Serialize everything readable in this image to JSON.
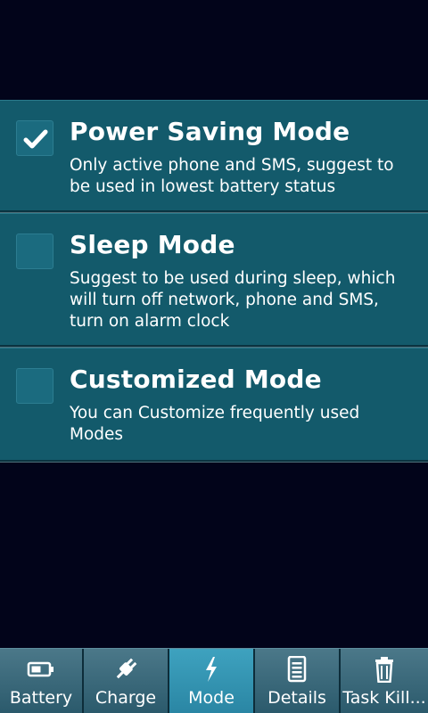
{
  "modes": [
    {
      "title": "Power Saving Mode",
      "description": "Only active phone and SMS, suggest to be used in lowest battery status",
      "checked": true
    },
    {
      "title": "Sleep Mode",
      "description": "Suggest to be used during sleep, which will turn off network, phone and SMS, turn on alarm clock",
      "checked": false
    },
    {
      "title": "Customized Mode",
      "description": "You can Customize frequently used Modes",
      "checked": false
    }
  ],
  "tabs": [
    {
      "label": "Battery",
      "icon": "battery-icon",
      "active": false
    },
    {
      "label": "Charge",
      "icon": "plug-icon",
      "active": false
    },
    {
      "label": "Mode",
      "icon": "lightning-icon",
      "active": true
    },
    {
      "label": "Details",
      "icon": "document-icon",
      "active": false
    },
    {
      "label": "Task Kill...",
      "icon": "trash-icon",
      "active": false
    }
  ],
  "colors": {
    "background": "#02041a",
    "card": "#135a6b",
    "tab_active": "#3ea2bf",
    "tab_inactive": "#3b6b7d"
  }
}
